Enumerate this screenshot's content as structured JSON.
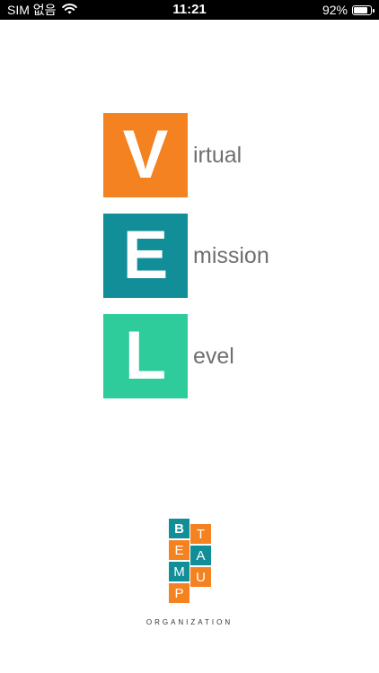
{
  "status_bar": {
    "carrier": "SIM 없음",
    "time": "11:21",
    "battery_percent": "92%",
    "battery_level": 0.92
  },
  "vel_logo": {
    "rows": [
      {
        "letter": "V",
        "word": "irtual",
        "color": "#f58220"
      },
      {
        "letter": "E",
        "word": "mission",
        "color": "#128e99"
      },
      {
        "letter": "L",
        "word": "evel",
        "color": "#2ecc9a"
      }
    ]
  },
  "org_logo": {
    "tiles": [
      "B",
      "E",
      "M",
      "P",
      "T",
      "A",
      "U"
    ],
    "colors": {
      "orange": "#f58220",
      "teal": "#128e99"
    },
    "caption": "ORGANIZATION"
  }
}
